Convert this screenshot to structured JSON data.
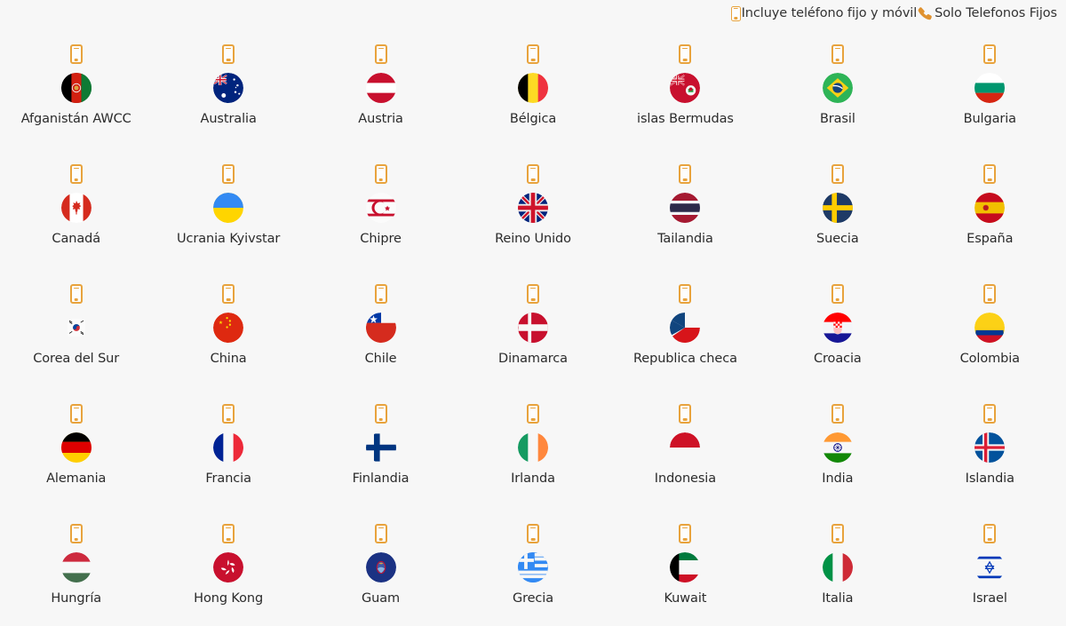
{
  "legend": {
    "items": [
      {
        "icon": "mobile-icon",
        "label": "Incluye teléfono fijo y móvil"
      },
      {
        "icon": "telephone-receiver-icon",
        "label": "Solo Telefonos Fijos"
      }
    ]
  },
  "colors": {
    "background": "#f7f7f7",
    "phone_icon": "#e8a33d",
    "label_text": "#2b2b2b",
    "legend_text": "#333333"
  },
  "grid": {
    "columns": 7,
    "items": [
      {
        "name": "Afganistán AWCC",
        "flag": "flag-af",
        "phone": "mobile-icon"
      },
      {
        "name": "Australia",
        "flag": "flag-au",
        "phone": "mobile-icon"
      },
      {
        "name": "Austria",
        "flag": "flag-at",
        "phone": "mobile-icon"
      },
      {
        "name": "Bélgica",
        "flag": "flag-be",
        "phone": "mobile-icon"
      },
      {
        "name": "islas Bermudas",
        "flag": "flag-bm",
        "phone": "mobile-icon"
      },
      {
        "name": "Brasil",
        "flag": "flag-br",
        "phone": "mobile-icon"
      },
      {
        "name": "Bulgaria",
        "flag": "flag-bg",
        "phone": "mobile-icon"
      },
      {
        "name": "Canadá",
        "flag": "flag-ca",
        "phone": "mobile-icon"
      },
      {
        "name": "Ucrania Kyivstar",
        "flag": "flag-ua",
        "phone": "mobile-icon"
      },
      {
        "name": "Chipre",
        "flag": "flag-cy",
        "phone": "mobile-icon"
      },
      {
        "name": "Reino Unido",
        "flag": "flag-gb",
        "phone": "mobile-icon"
      },
      {
        "name": "Tailandia",
        "flag": "flag-th",
        "phone": "mobile-icon"
      },
      {
        "name": "Suecia",
        "flag": "flag-se",
        "phone": "mobile-icon"
      },
      {
        "name": "España",
        "flag": "flag-es",
        "phone": "mobile-icon"
      },
      {
        "name": "Corea del Sur",
        "flag": "flag-kr",
        "phone": "mobile-icon"
      },
      {
        "name": "China",
        "flag": "flag-cn",
        "phone": "mobile-icon"
      },
      {
        "name": "Chile",
        "flag": "flag-cl",
        "phone": "mobile-icon"
      },
      {
        "name": "Dinamarca",
        "flag": "flag-dk",
        "phone": "mobile-icon"
      },
      {
        "name": "Republica checa",
        "flag": "flag-cz",
        "phone": "mobile-icon"
      },
      {
        "name": "Croacia",
        "flag": "flag-hr",
        "phone": "mobile-icon"
      },
      {
        "name": "Colombia",
        "flag": "flag-co",
        "phone": "mobile-icon"
      },
      {
        "name": "Alemania",
        "flag": "flag-de",
        "phone": "mobile-icon"
      },
      {
        "name": "Francia",
        "flag": "flag-fr",
        "phone": "mobile-icon"
      },
      {
        "name": "Finlandia",
        "flag": "flag-fi",
        "phone": "mobile-icon"
      },
      {
        "name": "Irlanda",
        "flag": "flag-ie",
        "phone": "mobile-icon"
      },
      {
        "name": "Indonesia",
        "flag": "flag-id",
        "phone": "mobile-icon"
      },
      {
        "name": "India",
        "flag": "flag-in",
        "phone": "mobile-icon"
      },
      {
        "name": "Islandia",
        "flag": "flag-is",
        "phone": "mobile-icon"
      },
      {
        "name": "Hungría",
        "flag": "flag-hu",
        "phone": "mobile-icon"
      },
      {
        "name": "Hong Kong",
        "flag": "flag-hk",
        "phone": "mobile-icon"
      },
      {
        "name": "Guam",
        "flag": "flag-gu",
        "phone": "mobile-icon"
      },
      {
        "name": "Grecia",
        "flag": "flag-gr",
        "phone": "mobile-icon"
      },
      {
        "name": "Kuwait",
        "flag": "flag-kw",
        "phone": "mobile-icon"
      },
      {
        "name": "Italia",
        "flag": "flag-it",
        "phone": "mobile-icon"
      },
      {
        "name": "Israel",
        "flag": "flag-il",
        "phone": "mobile-icon"
      }
    ]
  }
}
